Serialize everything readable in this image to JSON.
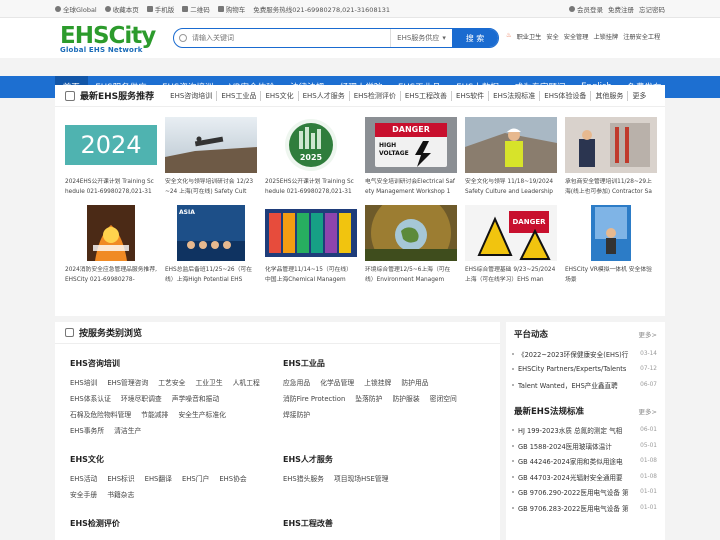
{
  "topbar": {
    "items": [
      {
        "label": "全球Global",
        "icon": "location-pin-icon"
      },
      {
        "label": "收藏本页",
        "icon": "star-icon"
      },
      {
        "label": "手机版",
        "icon": "mobile-icon"
      },
      {
        "label": "二维码",
        "icon": "qrcode-icon"
      },
      {
        "label": "购物车",
        "icon": "cart-icon"
      }
    ],
    "hotline": "免费服务热线021-69980278,021-31608131",
    "right": [
      {
        "label": "会员登录",
        "icon": "user-icon"
      },
      {
        "label": "免费注册"
      },
      {
        "label": "忘记密码"
      }
    ]
  },
  "logo": {
    "text1": "EHS",
    "text2": "City",
    "sub": "Global EHS Network"
  },
  "search": {
    "placeholder": "请输入关键词",
    "category": "EHS服务供应",
    "button": "搜 索"
  },
  "hotlinks": [
    "职业卫生",
    "安全",
    "安全管理",
    "上锁挂牌",
    "注册安全工程"
  ],
  "nav": [
    "首页",
    "EHS服务供应",
    "EHS咨询培训",
    "VR安全体验",
    "法律法规",
    "经理人学院",
    "EHS工业品",
    "EHS大数据",
    "成为专家顾问",
    "English",
    "免费发布"
  ],
  "recommend": {
    "title": "最新EHS服务推荐",
    "tags": [
      "EHS咨询培训",
      "EHS工业品",
      "EHS文化",
      "EHS人才服务",
      "EHS检测评价",
      "EHS工程改善",
      "EHS软件",
      "EHS法规标准",
      "EHS体验设备",
      "其他服务",
      "更多"
    ],
    "cards": [
      {
        "title": "2024EHS公开课计划 Training Schedule 021-69980278,021-31",
        "thumb": "thumb-2024",
        "label": "2024"
      },
      {
        "title": "安全文化与领导培训研讨会 12/23~24 上海(可在线) Safety Cult",
        "thumb": "thumb-leadership"
      },
      {
        "title": "2025EHS公开课计划 Training Schedule 021-69980278,021-31",
        "thumb": "thumb-2025",
        "label": "2025"
      },
      {
        "title": "电气安全培训研讨会Electrical Safety Management Workshop 1",
        "thumb": "thumb-danger",
        "label1": "DANGER",
        "label2": "HIGH VOLTAGE"
      },
      {
        "title": "安全文化与领导 11/18~19/2024 Safety Culture and Leadership",
        "thumb": "thumb-worker"
      },
      {
        "title": "承包商安全管理培训11/28~29上海(线上也可参加) Contractor Sa",
        "thumb": "thumb-contractor"
      },
      {
        "title": "2024消防安全应急管理品服务推荐, EHSCity 021-69980278-",
        "thumb": "thumb-fire"
      },
      {
        "title": "EHS总监后备班11/25~26（可在线）上海High Potential EHS",
        "thumb": "thumb-group",
        "label": "ASIA"
      },
      {
        "title": "化学品管理11/14~15（可在线）中国上海Chemical Managem",
        "thumb": "thumb-chemical"
      },
      {
        "title": "环境综合管理12/5~6上海（可在线）Environment Managem",
        "thumb": "thumb-globe"
      },
      {
        "title": "EHS综合管理基础 9/23~25/2024 上海（可在线学习）EHS man",
        "thumb": "thumb-signs",
        "label": "DANGER"
      },
      {
        "title": "EHSCity VR模拟一体机 安全体验场景",
        "thumb": "thumb-vr"
      }
    ]
  },
  "categories": {
    "title": "按服务类别浏览",
    "blocks": [
      {
        "title": "EHS咨询培训",
        "items": [
          "EHS培训",
          "EHS管理咨询",
          "工艺安全",
          "工业卫生",
          "人机工程",
          "EHS体系认证",
          "环境尽职调查",
          "声学噪音和振动",
          "石棉及危险物料管理",
          "节能减排",
          "安全生产标准化",
          "EHS事务所",
          "清洁生产"
        ]
      },
      {
        "title": "EHS工业品",
        "items": [
          "应急用品",
          "化学品管理",
          "上锁挂牌",
          "防护用品",
          "消防Fire Protection",
          "坠落防护",
          "防护服装",
          "密闭空间",
          "焊接防护"
        ]
      },
      {
        "title": "EHS文化",
        "items": [
          "EHS活动",
          "EHS标识",
          "EHS翻译",
          "EHS门户",
          "EHS协会",
          "安全手册",
          "书籍杂志"
        ]
      },
      {
        "title": "EHS人才服务",
        "items": [
          "EHS猎头服务",
          "项目现场HSE管理"
        ]
      },
      {
        "title": "EHS检测评价",
        "items": []
      },
      {
        "title": "EHS工程改善",
        "items": []
      }
    ]
  },
  "platform": {
    "title": "平台动态",
    "more": "更多>",
    "items": [
      {
        "text": "《2022~2023环保健康安全(EHS)行",
        "date": "03-14"
      },
      {
        "text": "EHSCity Partners/Experts/Talents",
        "date": "07-12"
      },
      {
        "text": "Talent Wanted，EHS产业鑫直聘",
        "date": "06-07"
      }
    ]
  },
  "regs": {
    "title": "最新EHS法规标准",
    "more": "更多>",
    "items": [
      {
        "text": "HJ 199-2023水质 总氮的测定 气相",
        "date": "06-01"
      },
      {
        "text": "GB 1588-2024医用玻璃体温计",
        "date": "05-01"
      },
      {
        "text": "GB 44246-2024家用和类似用途电",
        "date": "01-08"
      },
      {
        "text": "GB 44703-2024光辐射安全通用要",
        "date": "01-08"
      },
      {
        "text": "GB 9706.290-2022医用电气设备 第",
        "date": "01-01"
      },
      {
        "text": "GB 9706.283-2022医用电气设备 第",
        "date": "01-01"
      }
    ]
  }
}
